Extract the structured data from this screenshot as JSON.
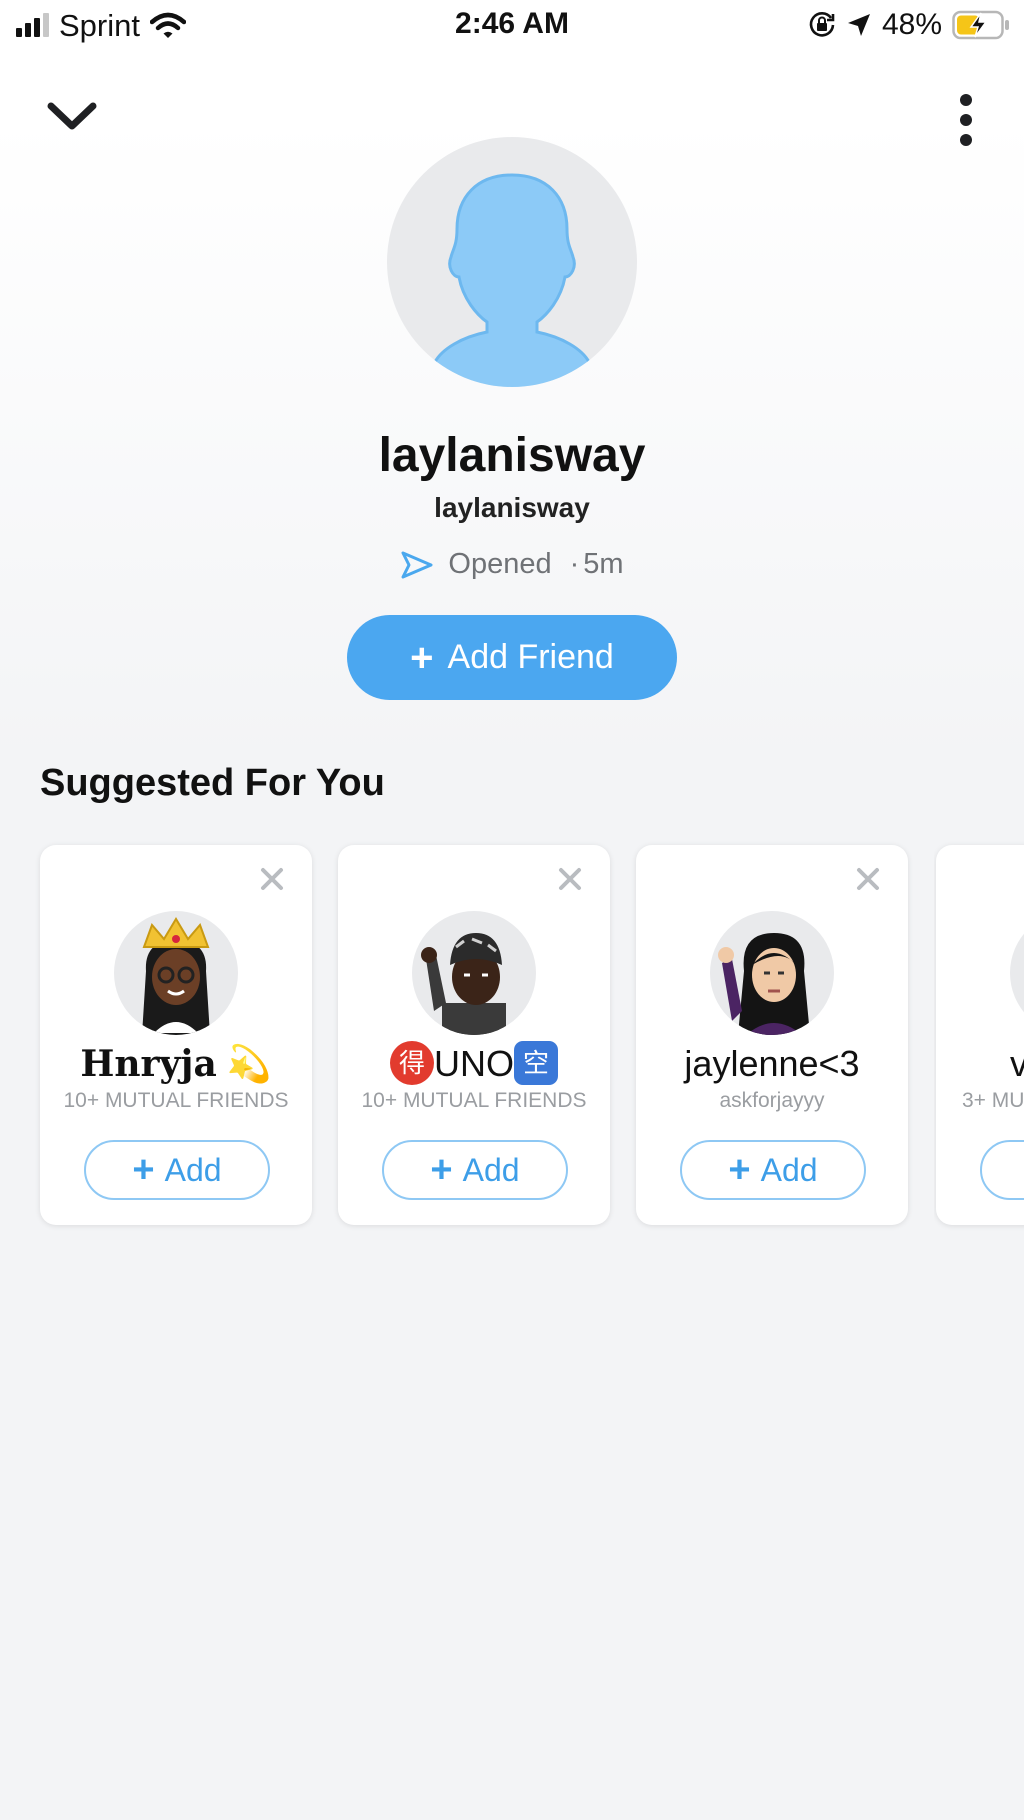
{
  "status_bar": {
    "carrier": "Sprint",
    "time": "2:46 AM",
    "battery": "48%"
  },
  "profile": {
    "display_name": "laylanisway",
    "username": "laylanisway",
    "status": "Opened",
    "status_time": "5m",
    "add_friend_label": "Add Friend"
  },
  "suggested": {
    "title": "Suggested For You",
    "cards": [
      {
        "name": "Hnryja",
        "emoji": "💫",
        "sub": "10+ MUTUAL FRIENDS",
        "add_label": "Add"
      },
      {
        "name": "UNO",
        "emoji_left": "得",
        "emoji_right": "空",
        "sub": "10+ MUTUAL FRIENDS",
        "add_label": "Add"
      },
      {
        "name": "jaylenne<3",
        "sub": "askforjayyy",
        "add_label": "Add"
      },
      {
        "name": "v",
        "sub": "3+ MU",
        "add_label": "+"
      }
    ]
  },
  "icons": {
    "collapse": "chevron-down-icon",
    "more": "more-vertical-icon",
    "status": "send-arrow-icon"
  },
  "colors": {
    "accent": "#4ba7f0",
    "avatar_silhouette": "#8ccaf7"
  }
}
